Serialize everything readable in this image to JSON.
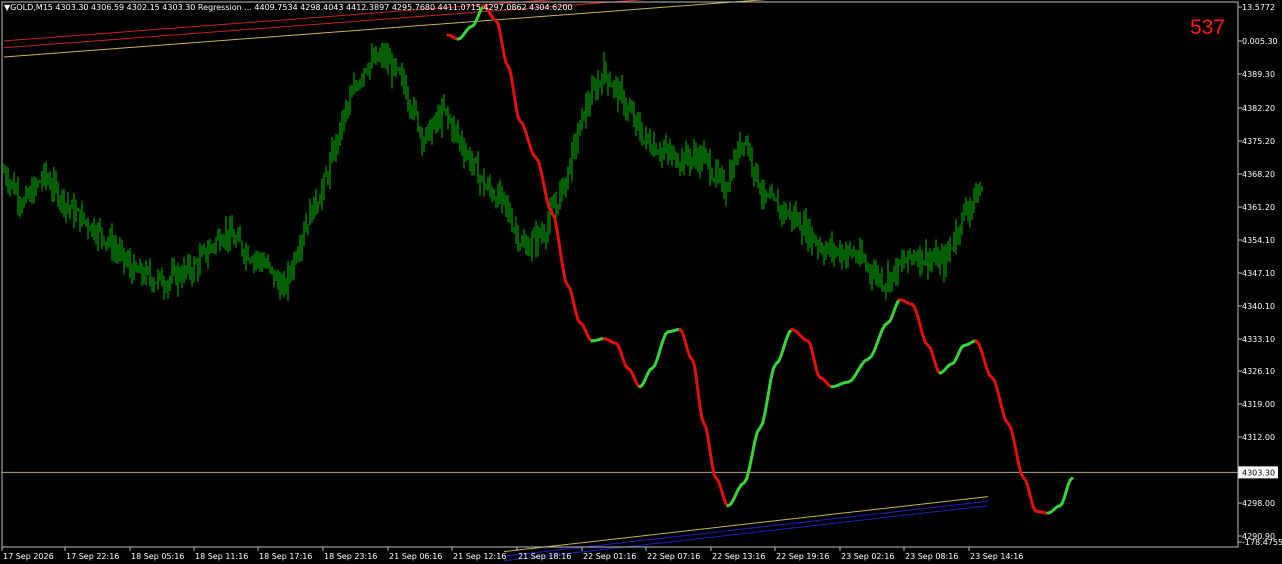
{
  "header": {
    "text": "▼GOLD,M15  4303.30  4306.59 4302.15 4303.30  Regression ...  4409.7534 4298.4043 4412.3897 4295.7680 4411.0715 4297.0862 4304.6200"
  },
  "counter": "537",
  "colors": {
    "background": "#000000",
    "candles": "#00c000",
    "curve_up": "#3ad23a",
    "curve_down": "#e01010",
    "channel_yellow": "#c8b850",
    "channel_red": "#d02020",
    "channel_blue": "#2020c0",
    "price_line": "#b8a870"
  },
  "chart_data": {
    "type": "line",
    "symbol": "GOLD",
    "timeframe": "M15",
    "last_price": "4303.30",
    "y_ticks": [
      "13.5772",
      "0.005.30",
      "4389.30",
      "4382.20",
      "4375.20",
      "4368.20",
      "4361.20",
      "4354.10",
      "4347.10",
      "4340.10",
      "4333.10",
      "4326.10",
      "4319.00",
      "4312.00",
      "4305.00",
      "4298.00",
      "4290.90",
      "-178.4755"
    ],
    "x_ticks": [
      "17 Sep 2026",
      "17 Sep 22:16",
      "18 Sep 05:16",
      "18 Sep 11:16",
      "18 Sep 17:16",
      "18 Sep 23:16",
      "21 Sep 06:16",
      "21 Sep 12:16",
      "21 Sep 18:16",
      "22 Sep 01:16",
      "22 Sep 07:16",
      "22 Sep 13:16",
      "22 Sep 19:16",
      "23 Sep 02:16",
      "23 Sep 08:16",
      "23 Sep 14:16"
    ],
    "ylim": [
      4287.0,
      4406.0
    ],
    "bars_count": 490,
    "price_anchors": [
      [
        0,
        4369
      ],
      [
        10,
        4362
      ],
      [
        20,
        4368
      ],
      [
        35,
        4360
      ],
      [
        50,
        4355
      ],
      [
        65,
        4347
      ],
      [
        80,
        4345
      ],
      [
        95,
        4348
      ],
      [
        110,
        4356
      ],
      [
        120,
        4352
      ],
      [
        130,
        4349
      ],
      [
        140,
        4343
      ],
      [
        150,
        4357
      ],
      [
        160,
        4366
      ],
      [
        170,
        4381
      ],
      [
        180,
        4392
      ],
      [
        190,
        4394
      ],
      [
        200,
        4388
      ],
      [
        210,
        4376
      ],
      [
        220,
        4382
      ],
      [
        230,
        4374
      ],
      [
        240,
        4366
      ],
      [
        250,
        4362
      ],
      [
        260,
        4352
      ],
      [
        270,
        4356
      ],
      [
        280,
        4366
      ],
      [
        290,
        4382
      ],
      [
        300,
        4391
      ],
      [
        310,
        4384
      ],
      [
        320,
        4376
      ],
      [
        335,
        4372
      ],
      [
        350,
        4372
      ],
      [
        360,
        4365
      ],
      [
        370,
        4377
      ],
      [
        380,
        4363
      ],
      [
        395,
        4359
      ],
      [
        410,
        4352
      ],
      [
        425,
        4351
      ],
      [
        440,
        4345
      ],
      [
        455,
        4351
      ],
      [
        470,
        4349
      ],
      [
        480,
        4360
      ],
      [
        490,
        4366
      ]
    ],
    "regression_curve": [
      [
        0,
        4398.8
      ],
      [
        5,
        4397.9
      ],
      [
        12,
        4400.7
      ],
      [
        18,
        4405.0
      ],
      [
        24,
        4402.0
      ],
      [
        30,
        4392.0
      ],
      [
        36,
        4380.0
      ],
      [
        44,
        4372.0
      ],
      [
        52,
        4360.0
      ],
      [
        60,
        4344.0
      ],
      [
        66,
        4336.0
      ],
      [
        72,
        4332.0
      ],
      [
        78,
        4332.5
      ],
      [
        84,
        4331.5
      ],
      [
        90,
        4326.0
      ],
      [
        96,
        4322.0
      ],
      [
        102,
        4326.0
      ],
      [
        110,
        4334.0
      ],
      [
        116,
        4334.5
      ],
      [
        122,
        4328.0
      ],
      [
        128,
        4314.0
      ],
      [
        134,
        4302.0
      ],
      [
        140,
        4296.0
      ],
      [
        148,
        4301.0
      ],
      [
        156,
        4313.0
      ],
      [
        164,
        4327.0
      ],
      [
        172,
        4334.5
      ],
      [
        180,
        4332.0
      ],
      [
        186,
        4324.0
      ],
      [
        192,
        4322.0
      ],
      [
        200,
        4323.0
      ],
      [
        210,
        4328.0
      ],
      [
        220,
        4336.0
      ],
      [
        226,
        4341.0
      ],
      [
        232,
        4340.0
      ],
      [
        240,
        4331.0
      ],
      [
        246,
        4325.0
      ],
      [
        252,
        4327.0
      ],
      [
        258,
        4331.0
      ],
      [
        264,
        4332.0
      ],
      [
        272,
        4324.0
      ],
      [
        280,
        4314.0
      ],
      [
        288,
        4302.0
      ],
      [
        294,
        4294.8
      ],
      [
        300,
        4294.4
      ],
      [
        306,
        4296.0
      ],
      [
        312,
        4302.0
      ]
    ],
    "curve_start_bar": 222
  }
}
